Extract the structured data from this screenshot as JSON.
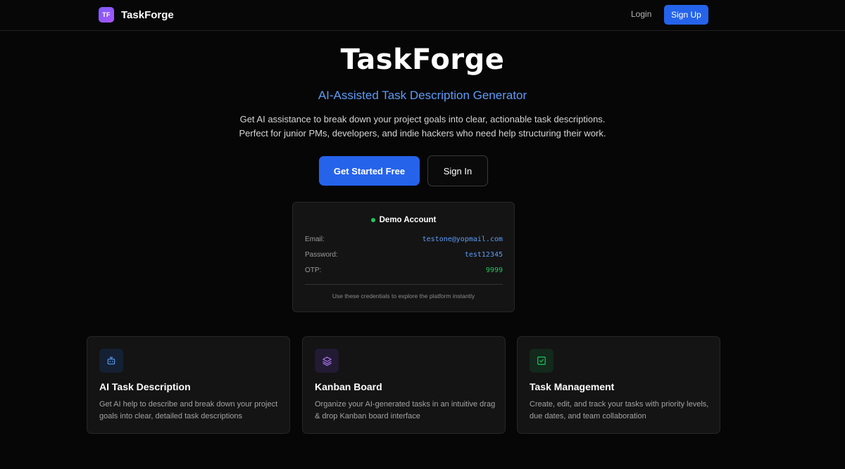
{
  "nav": {
    "logo_text": "TF",
    "brand": "TaskForge",
    "login": "Login",
    "signup": "Sign Up"
  },
  "hero": {
    "title": "TaskForge",
    "subtitle": "AI-Assisted Task Description Generator",
    "desc_line1": "Get AI assistance to break down your project goals into clear, actionable task descriptions.",
    "desc_line2": "Perfect for junior PMs, developers, and indie hackers who need help structuring their work.",
    "cta_primary": "Get Started Free",
    "cta_secondary": "Sign In"
  },
  "demo": {
    "title": "Demo Account",
    "rows": [
      {
        "label": "Email:",
        "value": "testone@yopmail.com"
      },
      {
        "label": "Password:",
        "value": "test12345"
      },
      {
        "label": "OTP:",
        "value": "9999"
      }
    ],
    "note": "Use these credentials to explore the platform instantly"
  },
  "features": [
    {
      "icon": "bot-icon",
      "title": "AI Task Description",
      "desc": "Get AI help to describe and break down your project goals into clear, detailed task descriptions"
    },
    {
      "icon": "layers-icon",
      "title": "Kanban Board",
      "desc": "Organize your AI-generated tasks in an intuitive drag & drop Kanban board interface"
    },
    {
      "icon": "check-square-icon",
      "title": "Task Management",
      "desc": "Create, edit, and track your tasks with priority levels, due dates, and team collaboration"
    }
  ],
  "colors": {
    "accent": "#2563eb",
    "subtitle_blue": "#5b9cf6",
    "status_green": "#22c55e",
    "logo_purple": "#7c5cff"
  }
}
